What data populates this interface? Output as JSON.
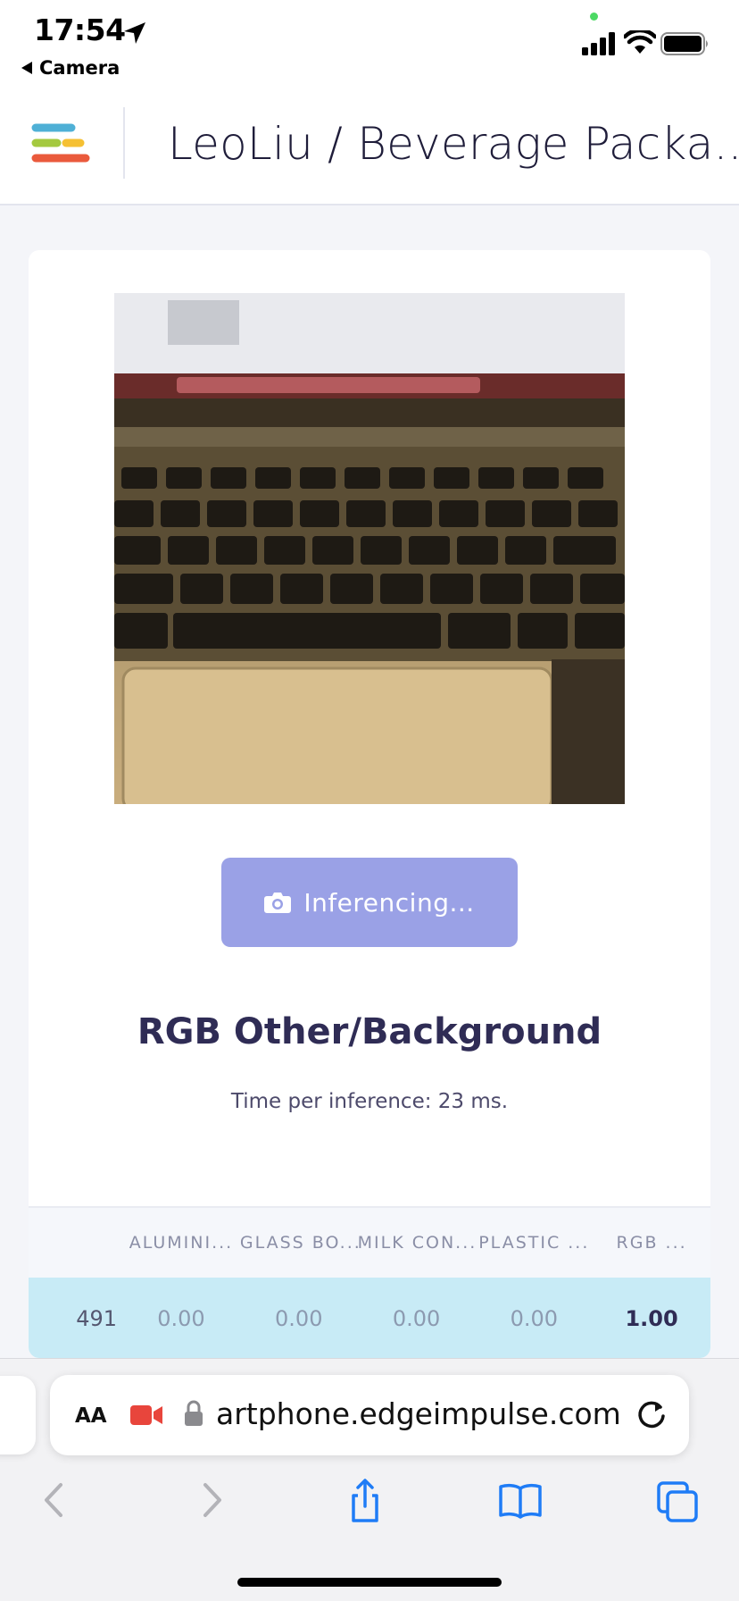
{
  "status_bar": {
    "time": "17:54",
    "back_app": "Camera"
  },
  "header": {
    "project_title": "LeoLiu / Beverage Packa..."
  },
  "inference": {
    "button_label": "Inferencing...",
    "result_label": "RGB Other/Background",
    "time_per_inference": "Time per inference: 23 ms."
  },
  "table": {
    "headers": [
      "ALUMINI...",
      "GLASS BO...",
      "MILK CON...",
      "PLASTIC ...",
      "RGB ..."
    ],
    "rows": [
      {
        "index": "491",
        "values": [
          "0.00",
          "0.00",
          "0.00",
          "0.00",
          "1.00"
        ]
      }
    ]
  },
  "browser": {
    "aa_label": "AA",
    "url": "artphone.edgeimpulse.com"
  },
  "colors": {
    "button": "#9aa1e6",
    "result_row": "#c8ebf6",
    "title_text": "#2f2c55"
  }
}
